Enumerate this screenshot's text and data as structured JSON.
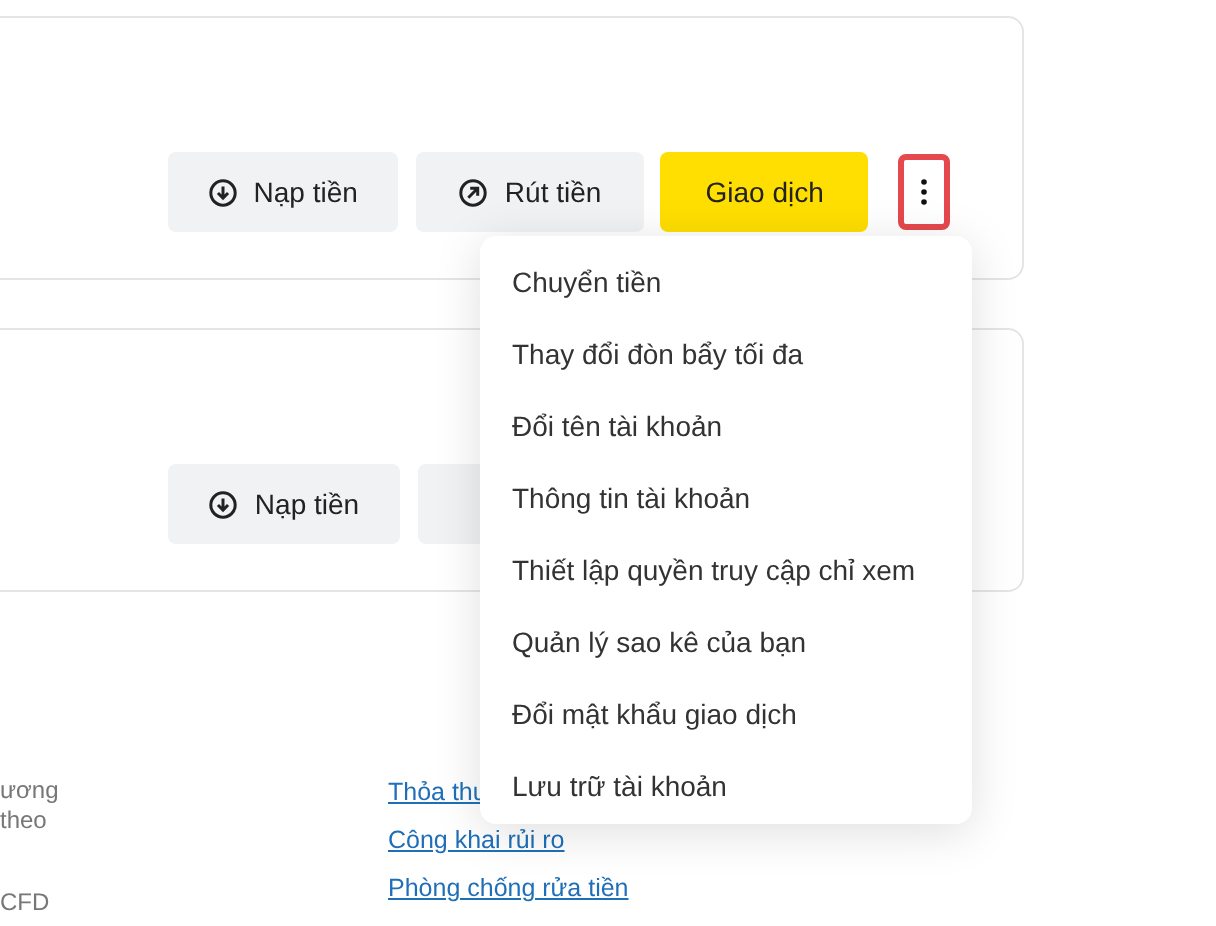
{
  "accounts": [
    {
      "buttons": [
        {
          "kind": "deposit",
          "label": "Nạp tiền"
        },
        {
          "kind": "withdraw",
          "label": "Rút tiền"
        },
        {
          "kind": "trade",
          "label": "Giao dịch"
        }
      ],
      "more_menu_open": true
    },
    {
      "buttons": [
        {
          "kind": "deposit",
          "label": "Nạp tiền"
        },
        {
          "kind": "withdraw"
        }
      ]
    }
  ],
  "menu": {
    "items": [
      "Chuyển tiền",
      "Thay đổi đòn bẩy tối đa",
      "Đổi tên tài khoản",
      "Thông tin tài khoản",
      "Thiết lập quyền truy cập chỉ xem",
      "Quản lý sao kê của bạn",
      "Đổi mật khẩu giao dịch",
      "Lưu trữ tài khoản"
    ]
  },
  "footer": {
    "text_fragments": [
      "ương",
      "theo",
      "CFD"
    ],
    "links": [
      "Thỏa thu",
      "Công khai rủi ro",
      "Phòng chống rửa tiền"
    ]
  }
}
